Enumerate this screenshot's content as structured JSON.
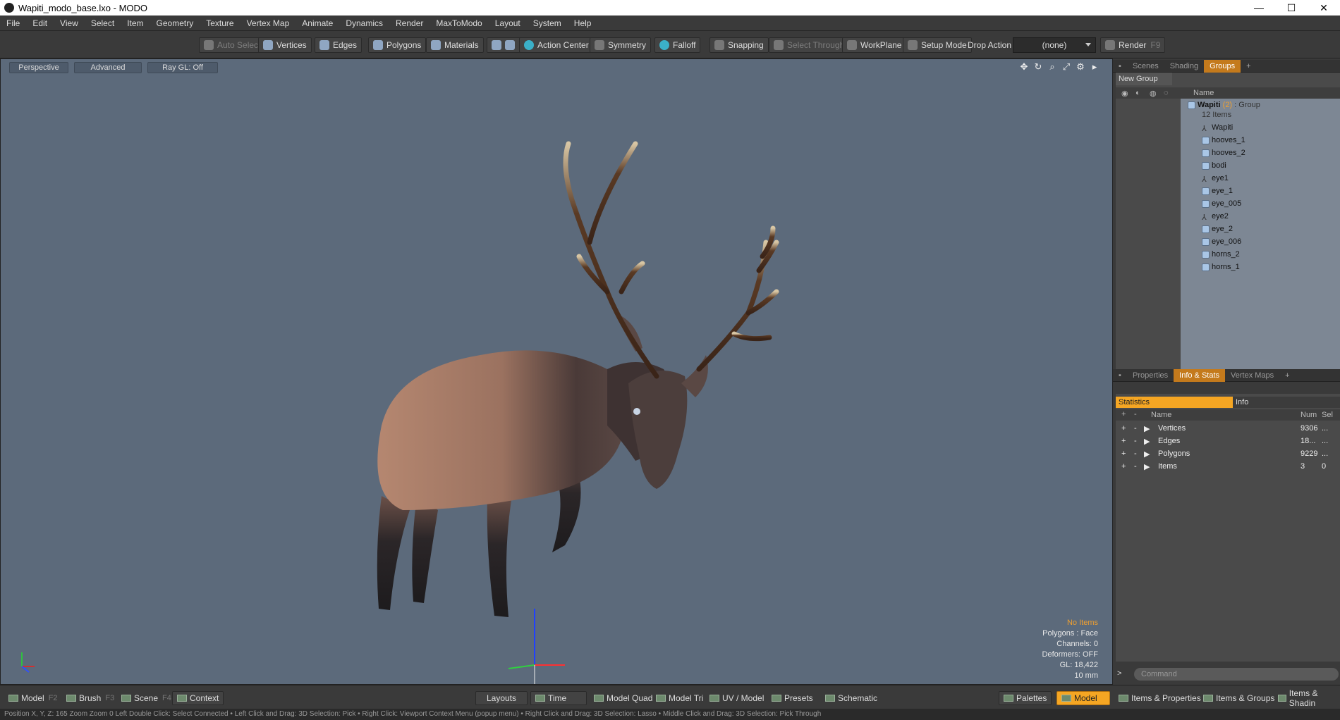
{
  "window": {
    "title": "Wapiti_modo_base.lxo - MODO",
    "controls": [
      "—",
      "☐",
      "✕"
    ]
  },
  "menu": [
    "File",
    "Edit",
    "View",
    "Select",
    "Item",
    "Geometry",
    "Texture",
    "Vertex Map",
    "Animate",
    "Dynamics",
    "Render",
    "MaxToModo",
    "Layout",
    "System",
    "Help"
  ],
  "toolbar": {
    "auto_select": "Auto Select",
    "vertices": "Vertices",
    "edges": "Edges",
    "polygons": "Polygons",
    "materials": "Materials",
    "action_center": "Action Center",
    "symmetry": "Symmetry",
    "falloff": "Falloff",
    "snapping": "Snapping",
    "select_through": "Select Through",
    "workplane": "WorkPlane",
    "setup_mode": "Setup Mode",
    "drop_action": "Drop Action",
    "drop_value": "(none)",
    "render": "Render",
    "render_key": "F9"
  },
  "viewport": {
    "perspective": "Perspective",
    "advanced": "Advanced",
    "raygl": "Ray GL: Off",
    "hud": {
      "no_items": "No Items",
      "polygons": "Polygons : Face",
      "channels": "Channels: 0",
      "deformers": "Deformers: OFF",
      "gl": "GL: 18,422",
      "scale": "10 mm"
    }
  },
  "groups_panel": {
    "tabs": [
      "Scenes",
      "Shading",
      "Groups",
      "+"
    ],
    "new_group": "New Group",
    "name_col": "Name",
    "group_name": "Wapiti",
    "group_count": "(2)",
    "group_type": ": Group",
    "items_count": "12 Items",
    "items": [
      "Wapiti",
      "hooves_1",
      "hooves_2",
      "bodi",
      "eye1",
      "eye_1",
      "eye_005",
      "eye2",
      "eye_2",
      "eye_006",
      "horns_2",
      "horns_1"
    ]
  },
  "stats_panel": {
    "tabs": [
      "Properties",
      "Info & Stats",
      "Vertex Maps",
      "+"
    ],
    "statistics": "Statistics",
    "info": "Info",
    "col_name": "Name",
    "col_num": "Num",
    "col_sel": "Sel",
    "rows": [
      {
        "name": "Vertices",
        "num": "9306",
        "sel": "..."
      },
      {
        "name": "Edges",
        "num": "18...",
        "sel": "..."
      },
      {
        "name": "Polygons",
        "num": "9229",
        "sel": "..."
      },
      {
        "name": "Items",
        "num": "3",
        "sel": "0"
      }
    ],
    "command": "Command"
  },
  "bottom": {
    "model": "Model",
    "model_key": "F2",
    "brush": "Brush",
    "brush_key": "F3",
    "scene": "Scene",
    "scene_key": "F4",
    "context": "Context",
    "layouts": "Layouts",
    "time": "Time",
    "model_quad": "Model Quad",
    "model_tri": "Model Tri",
    "uv_model": "UV / Model",
    "presets": "Presets",
    "schematic": "Schematic",
    "palettes": "Palettes",
    "model_active": "Model",
    "items_props": "Items & Properties",
    "items_groups": "Items & Groups",
    "items_shading": "Items & Shadin"
  },
  "statusbar": "Position X, Y, Z: 165 Zoom Zoom 0    Left Double Click: Select Connected • Left Click and Drag: 3D Selection: Pick • Right Click: Viewport Context Menu (popup menu) • Right Click and Drag: 3D Selection: Lasso • Middle Click and Drag: 3D Selection: Pick Through"
}
